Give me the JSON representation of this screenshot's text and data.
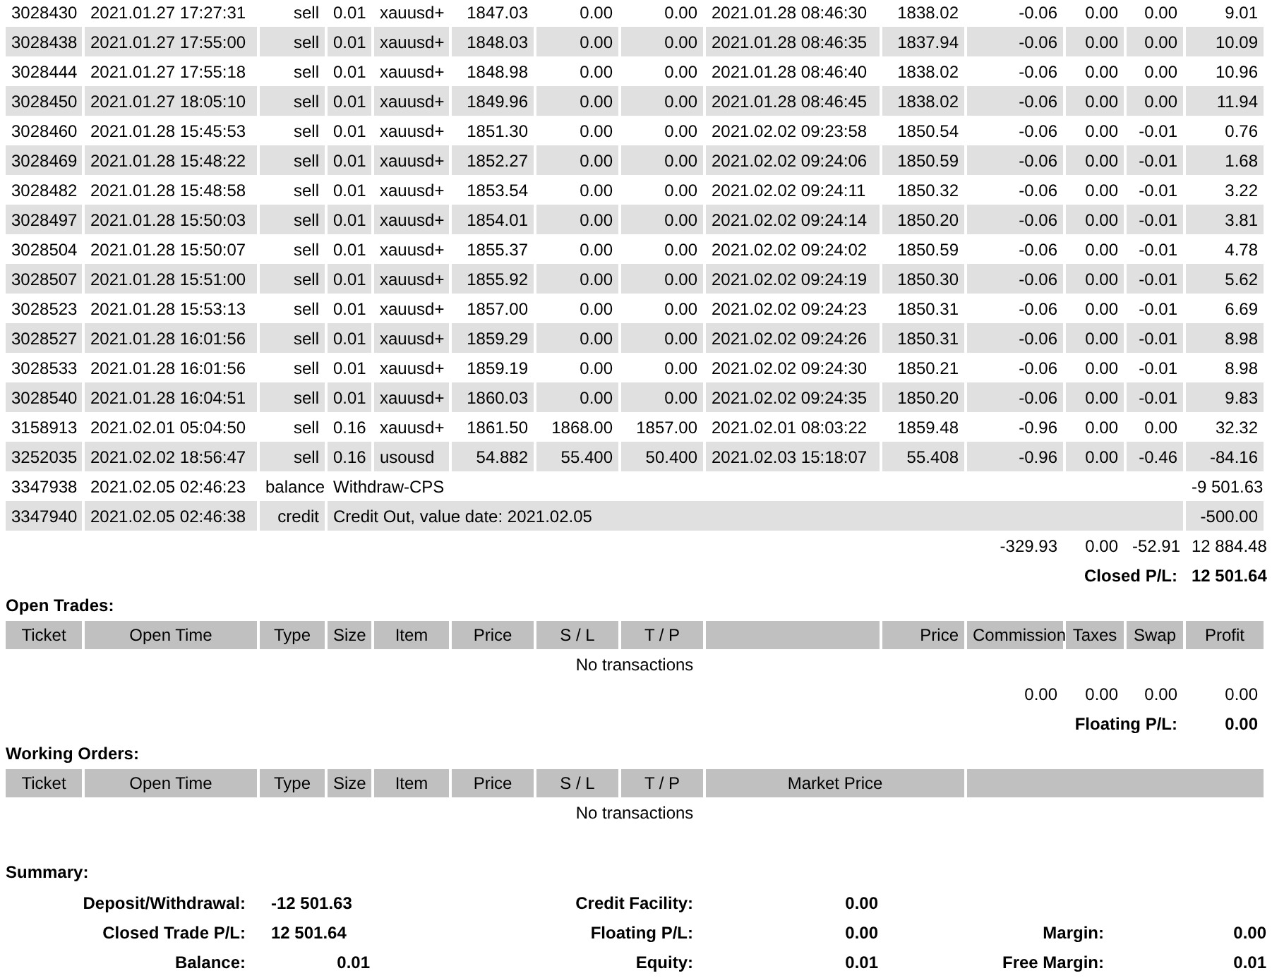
{
  "closed_transactions": {
    "rows": [
      {
        "ticket": "3028430",
        "open_time": "2021.01.27 17:27:31",
        "type": "sell",
        "size": "0.01",
        "item": "xauusd+",
        "price": "1847.03",
        "sl": "0.00",
        "tp": "0.00",
        "close_time": "2021.01.28 08:46:30",
        "close_price": "1838.02",
        "commission": "-0.06",
        "taxes": "0.00",
        "swap": "0.00",
        "profit": "9.01"
      },
      {
        "ticket": "3028438",
        "open_time": "2021.01.27 17:55:00",
        "type": "sell",
        "size": "0.01",
        "item": "xauusd+",
        "price": "1848.03",
        "sl": "0.00",
        "tp": "0.00",
        "close_time": "2021.01.28 08:46:35",
        "close_price": "1837.94",
        "commission": "-0.06",
        "taxes": "0.00",
        "swap": "0.00",
        "profit": "10.09"
      },
      {
        "ticket": "3028444",
        "open_time": "2021.01.27 17:55:18",
        "type": "sell",
        "size": "0.01",
        "item": "xauusd+",
        "price": "1848.98",
        "sl": "0.00",
        "tp": "0.00",
        "close_time": "2021.01.28 08:46:40",
        "close_price": "1838.02",
        "commission": "-0.06",
        "taxes": "0.00",
        "swap": "0.00",
        "profit": "10.96"
      },
      {
        "ticket": "3028450",
        "open_time": "2021.01.27 18:05:10",
        "type": "sell",
        "size": "0.01",
        "item": "xauusd+",
        "price": "1849.96",
        "sl": "0.00",
        "tp": "0.00",
        "close_time": "2021.01.28 08:46:45",
        "close_price": "1838.02",
        "commission": "-0.06",
        "taxes": "0.00",
        "swap": "0.00",
        "profit": "11.94"
      },
      {
        "ticket": "3028460",
        "open_time": "2021.01.28 15:45:53",
        "type": "sell",
        "size": "0.01",
        "item": "xauusd+",
        "price": "1851.30",
        "sl": "0.00",
        "tp": "0.00",
        "close_time": "2021.02.02 09:23:58",
        "close_price": "1850.54",
        "commission": "-0.06",
        "taxes": "0.00",
        "swap": "-0.01",
        "profit": "0.76"
      },
      {
        "ticket": "3028469",
        "open_time": "2021.01.28 15:48:22",
        "type": "sell",
        "size": "0.01",
        "item": "xauusd+",
        "price": "1852.27",
        "sl": "0.00",
        "tp": "0.00",
        "close_time": "2021.02.02 09:24:06",
        "close_price": "1850.59",
        "commission": "-0.06",
        "taxes": "0.00",
        "swap": "-0.01",
        "profit": "1.68"
      },
      {
        "ticket": "3028482",
        "open_time": "2021.01.28 15:48:58",
        "type": "sell",
        "size": "0.01",
        "item": "xauusd+",
        "price": "1853.54",
        "sl": "0.00",
        "tp": "0.00",
        "close_time": "2021.02.02 09:24:11",
        "close_price": "1850.32",
        "commission": "-0.06",
        "taxes": "0.00",
        "swap": "-0.01",
        "profit": "3.22"
      },
      {
        "ticket": "3028497",
        "open_time": "2021.01.28 15:50:03",
        "type": "sell",
        "size": "0.01",
        "item": "xauusd+",
        "price": "1854.01",
        "sl": "0.00",
        "tp": "0.00",
        "close_time": "2021.02.02 09:24:14",
        "close_price": "1850.20",
        "commission": "-0.06",
        "taxes": "0.00",
        "swap": "-0.01",
        "profit": "3.81"
      },
      {
        "ticket": "3028504",
        "open_time": "2021.01.28 15:50:07",
        "type": "sell",
        "size": "0.01",
        "item": "xauusd+",
        "price": "1855.37",
        "sl": "0.00",
        "tp": "0.00",
        "close_time": "2021.02.02 09:24:02",
        "close_price": "1850.59",
        "commission": "-0.06",
        "taxes": "0.00",
        "swap": "-0.01",
        "profit": "4.78"
      },
      {
        "ticket": "3028507",
        "open_time": "2021.01.28 15:51:00",
        "type": "sell",
        "size": "0.01",
        "item": "xauusd+",
        "price": "1855.92",
        "sl": "0.00",
        "tp": "0.00",
        "close_time": "2021.02.02 09:24:19",
        "close_price": "1850.30",
        "commission": "-0.06",
        "taxes": "0.00",
        "swap": "-0.01",
        "profit": "5.62"
      },
      {
        "ticket": "3028523",
        "open_time": "2021.01.28 15:53:13",
        "type": "sell",
        "size": "0.01",
        "item": "xauusd+",
        "price": "1857.00",
        "sl": "0.00",
        "tp": "0.00",
        "close_time": "2021.02.02 09:24:23",
        "close_price": "1850.31",
        "commission": "-0.06",
        "taxes": "0.00",
        "swap": "-0.01",
        "profit": "6.69"
      },
      {
        "ticket": "3028527",
        "open_time": "2021.01.28 16:01:56",
        "type": "sell",
        "size": "0.01",
        "item": "xauusd+",
        "price": "1859.29",
        "sl": "0.00",
        "tp": "0.00",
        "close_time": "2021.02.02 09:24:26",
        "close_price": "1850.31",
        "commission": "-0.06",
        "taxes": "0.00",
        "swap": "-0.01",
        "profit": "8.98"
      },
      {
        "ticket": "3028533",
        "open_time": "2021.01.28 16:01:56",
        "type": "sell",
        "size": "0.01",
        "item": "xauusd+",
        "price": "1859.19",
        "sl": "0.00",
        "tp": "0.00",
        "close_time": "2021.02.02 09:24:30",
        "close_price": "1850.21",
        "commission": "-0.06",
        "taxes": "0.00",
        "swap": "-0.01",
        "profit": "8.98"
      },
      {
        "ticket": "3028540",
        "open_time": "2021.01.28 16:04:51",
        "type": "sell",
        "size": "0.01",
        "item": "xauusd+",
        "price": "1860.03",
        "sl": "0.00",
        "tp": "0.00",
        "close_time": "2021.02.02 09:24:35",
        "close_price": "1850.20",
        "commission": "-0.06",
        "taxes": "0.00",
        "swap": "-0.01",
        "profit": "9.83"
      },
      {
        "ticket": "3158913",
        "open_time": "2021.02.01 05:04:50",
        "type": "sell",
        "size": "0.16",
        "item": "xauusd+",
        "price": "1861.50",
        "sl": "1868.00",
        "tp": "1857.00",
        "close_time": "2021.02.01 08:03:22",
        "close_price": "1859.48",
        "commission": "-0.96",
        "taxes": "0.00",
        "swap": "0.00",
        "profit": "32.32"
      },
      {
        "ticket": "3252035",
        "open_time": "2021.02.02 18:56:47",
        "type": "sell",
        "size": "0.16",
        "item": "usousd",
        "price": "54.882",
        "sl": "55.400",
        "tp": "50.400",
        "close_time": "2021.02.03 15:18:07",
        "close_price": "55.408",
        "commission": "-0.96",
        "taxes": "0.00",
        "swap": "-0.46",
        "profit": "-84.16"
      }
    ],
    "balance_rows": [
      {
        "ticket": "3347938",
        "time": "2021.02.05 02:46:23",
        "type": "balance",
        "comment": "Withdraw-CPS",
        "amount": "-9 501.63"
      },
      {
        "ticket": "3347940",
        "time": "2021.02.05 02:46:38",
        "type": "credit",
        "comment": "Credit Out, value date: 2021.02.05",
        "amount": "-500.00"
      }
    ],
    "totals": {
      "commission": "-329.93",
      "taxes": "0.00",
      "swap": "-52.91",
      "profit": "12 884.48"
    },
    "closed_pl": {
      "label": "Closed P/L:",
      "value": "12 501.64"
    }
  },
  "open_trades": {
    "title": "Open Trades:",
    "columns": [
      "Ticket",
      "Open Time",
      "Type",
      "Size",
      "Item",
      "Price",
      "S / L",
      "T / P",
      "Price",
      "Commission",
      "Taxes",
      "Swap",
      "Profit"
    ],
    "empty_text": "No transactions",
    "totals": {
      "commission": "0.00",
      "taxes": "0.00",
      "swap": "0.00",
      "profit": "0.00"
    },
    "floating_pl": {
      "label": "Floating P/L:",
      "value": "0.00"
    }
  },
  "working_orders": {
    "title": "Working Orders:",
    "columns": [
      "Ticket",
      "Open Time",
      "Type",
      "Size",
      "Item",
      "Price",
      "S / L",
      "T / P",
      "Market Price"
    ],
    "empty_text": "No transactions"
  },
  "summary": {
    "title": "Summary:",
    "rows": [
      [
        {
          "label": "Deposit/Withdrawal:",
          "value": "-12 501.63"
        },
        {
          "label": "Credit Facility:",
          "value": "0.00"
        }
      ],
      [
        {
          "label": "Closed Trade P/L:",
          "value": "12 501.64"
        },
        {
          "label": "Floating P/L:",
          "value": "0.00"
        },
        {
          "label": "Margin:",
          "value": "0.00"
        }
      ],
      [
        {
          "label": "Balance:",
          "value": "0.01"
        },
        {
          "label": "Equity:",
          "value": "0.01"
        },
        {
          "label": "Free Margin:",
          "value": "0.01"
        }
      ]
    ]
  }
}
